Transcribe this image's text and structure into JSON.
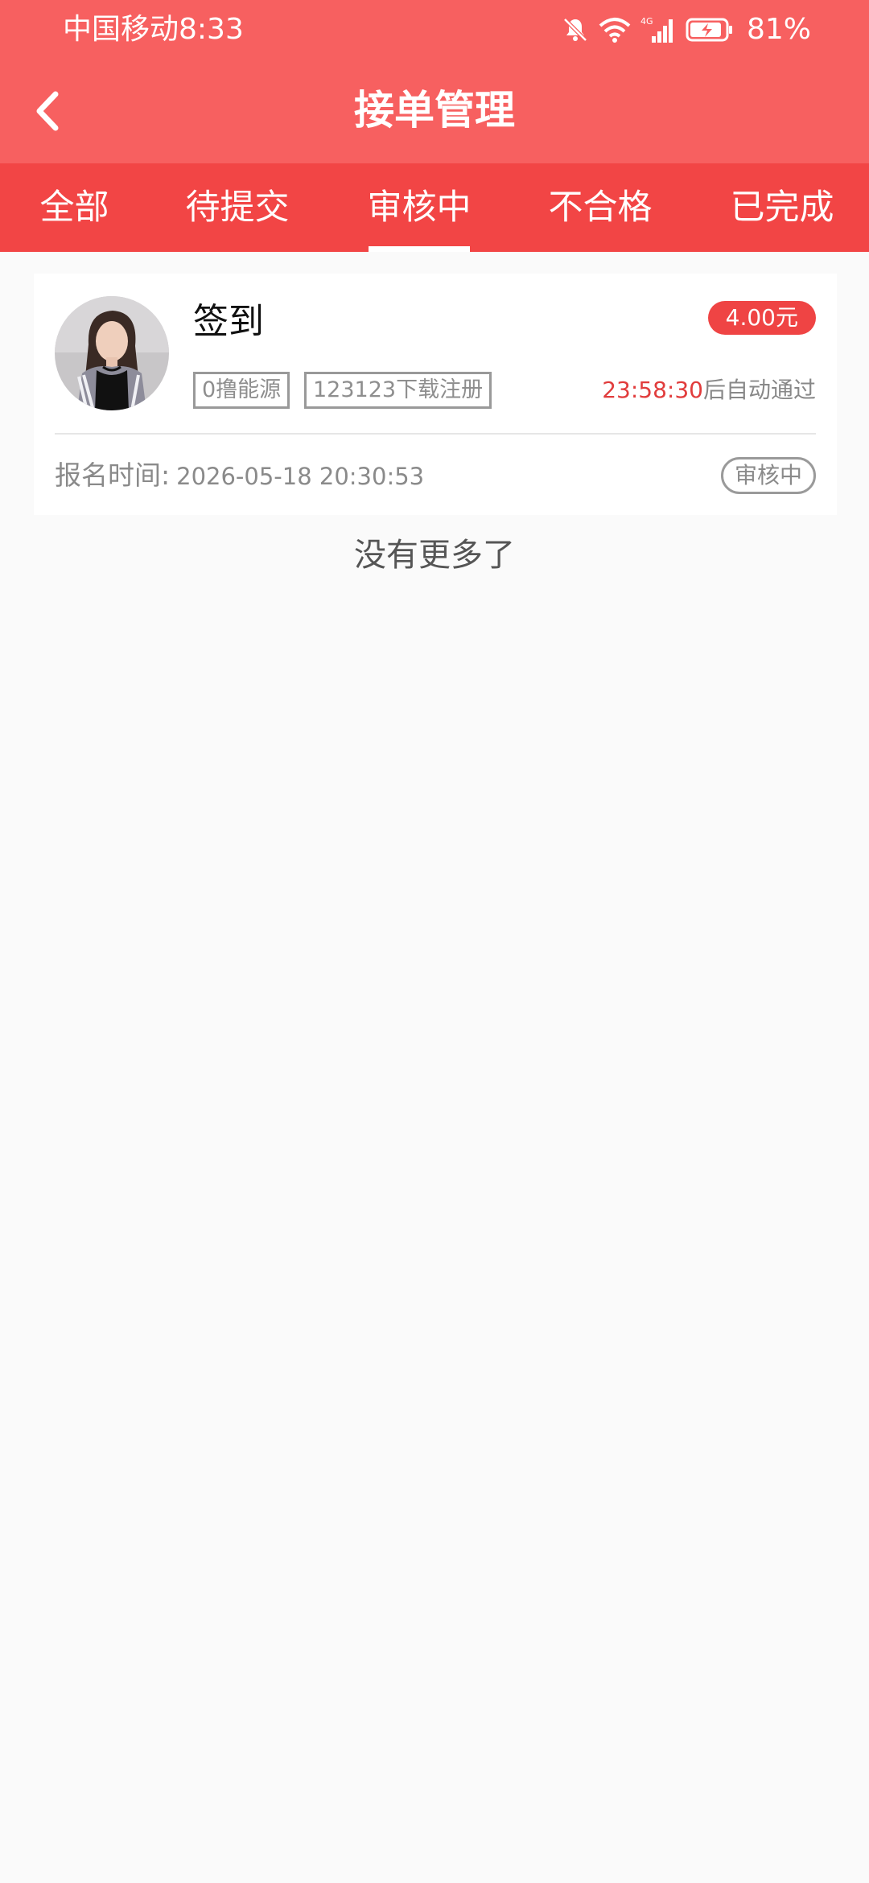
{
  "status_bar": {
    "carrier": "中国移动",
    "time": "8:33",
    "network": "4G",
    "battery": "81%"
  },
  "header": {
    "title": "接单管理",
    "back_icon": "chevron-left-icon"
  },
  "tabs": [
    {
      "label": "全部",
      "selected": false
    },
    {
      "label": "待提交",
      "selected": false
    },
    {
      "label": "审核中",
      "selected": true
    },
    {
      "label": "不合格",
      "selected": false
    },
    {
      "label": "已完成",
      "selected": false
    }
  ],
  "orders": [
    {
      "title": "签到",
      "price": "4.00元",
      "tags": [
        "0撸能源",
        "123123下载注册"
      ],
      "countdown_time": "23:58:30",
      "countdown_suffix": "后自动通过",
      "signup_label": "报名时间:",
      "signup_time": "2026-05-18 20:30:53",
      "status": "审核中"
    }
  ],
  "footer_text": "没有更多了",
  "colors": {
    "header_bg": "#f76060",
    "tabs_bg": "#f24545",
    "price_bg": "#ef4444",
    "countdown": "#e13c3c",
    "page_bg": "#fafafa"
  }
}
